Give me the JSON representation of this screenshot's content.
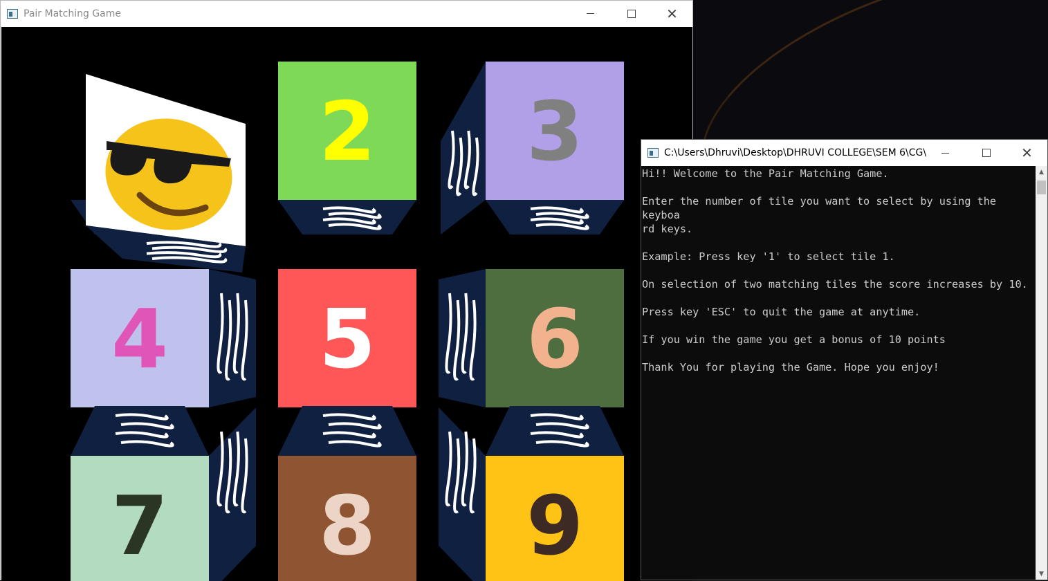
{
  "game_window": {
    "title": "Pair Matching Game",
    "controls": {
      "minimize": "minimize",
      "maximize": "maximize",
      "close": "close"
    },
    "tiles": [
      {
        "label": "",
        "face": "emoji",
        "icon": "sunglasses-emoji-icon",
        "bg": "#ffffff",
        "fg": "#f6c31a"
      },
      {
        "label": "2",
        "face": "number",
        "bg": "#7ed957",
        "fg": "#ffff00"
      },
      {
        "label": "3",
        "face": "number",
        "bg": "#b19fe8",
        "fg": "#808080"
      },
      {
        "label": "4",
        "face": "number",
        "bg": "#c0c2ee",
        "fg": "#df55b8"
      },
      {
        "label": "5",
        "face": "number",
        "bg": "#ff5757",
        "fg": "#ffffff"
      },
      {
        "label": "6",
        "face": "number",
        "bg": "#4e6e40",
        "fg": "#f2b28e"
      },
      {
        "label": "7",
        "face": "number",
        "bg": "#b3dbbf",
        "fg": "#2b3524"
      },
      {
        "label": "8",
        "face": "number",
        "bg": "#8f5431",
        "fg": "#ecd5c6"
      },
      {
        "label": "9",
        "face": "number",
        "bg": "#ffc316",
        "fg": "#3d2a24"
      }
    ],
    "side_color": "#102040"
  },
  "console_window": {
    "title": "C:\\Users\\Dhruvi\\Desktop\\DHRUVI COLLEGE\\SEM 6\\CG\\...",
    "lines": [
      "Hi!! Welcome to the Pair Matching Game.",
      "",
      "Enter the number of tile you want to select by using the keyboa",
      "rd keys.",
      "",
      "Example: Press key '1' to select tile 1.",
      "",
      "On selection of two matching tiles the score increases by 10.",
      "",
      "Press key 'ESC' to quit the game at anytime.",
      "",
      "If you win the game you get a bonus of 10 points",
      "",
      "Thank You for playing the Game. Hope you enjoy!"
    ]
  }
}
